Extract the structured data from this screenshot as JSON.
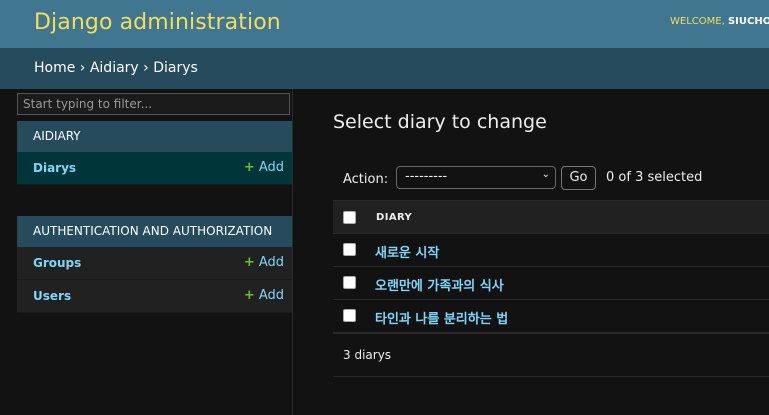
{
  "header": {
    "brand": "Django administration",
    "welcome_prefix": "WELCOME, ",
    "user": "SIUCHO"
  },
  "breadcrumbs": {
    "home": "Home",
    "app": "Aidiary",
    "current": "Diarys",
    "sep": " › "
  },
  "sidebar": {
    "filter_placeholder": "Start typing to filter...",
    "modules": [
      {
        "caption": "AIDIARY",
        "rows": [
          {
            "name": "Diarys",
            "add": "Add"
          }
        ]
      },
      {
        "caption": "AUTHENTICATION AND AUTHORIZATION",
        "rows": [
          {
            "name": "Groups",
            "add": "Add"
          },
          {
            "name": "Users",
            "add": "Add"
          }
        ]
      }
    ]
  },
  "main": {
    "title": "Select diary to change",
    "action_label": "Action:",
    "action_selected": "---------",
    "go_label": "Go",
    "selection_count": "0 of 3 selected",
    "column_header": "DIARY",
    "rows": [
      "새로운 시작",
      "오랜만에 가족과의 식사",
      "타인과 나를 분리하는 법"
    ],
    "paginator": "3 diarys"
  },
  "colors": {
    "header_bg": "#417690",
    "breadcrumb_bg": "#264b5d",
    "link": "#81d4fa",
    "add_plus": "#70bf2b",
    "brand": "#f5dd5d"
  }
}
